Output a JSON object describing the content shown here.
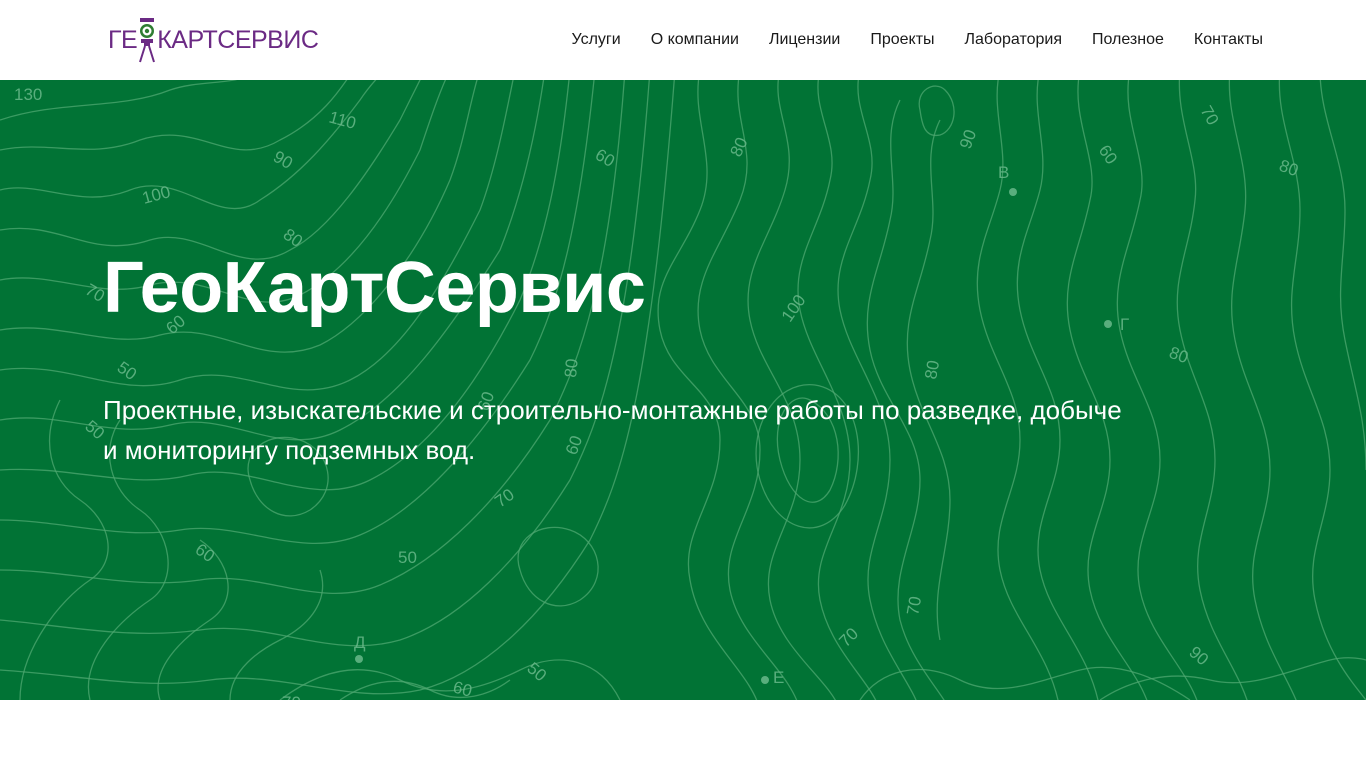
{
  "brand": {
    "logo_left": "ГЕ",
    "logo_right": "КАРТСЕРВИС",
    "logo_color": "#6b2a84",
    "mark_color": "#2e7d32"
  },
  "nav": {
    "items": [
      {
        "label": "Услуги"
      },
      {
        "label": "О компании"
      },
      {
        "label": "Лицензии"
      },
      {
        "label": "Проекты"
      },
      {
        "label": "Лаборатория"
      },
      {
        "label": "Полезное"
      },
      {
        "label": "Контакты"
      }
    ]
  },
  "hero": {
    "title": "ГеоКартСервис",
    "subtitle": "Проектные, изыскательские и строительно-монтажные работы по разведке, добыче и мониторингу подземных вод.",
    "bg_color": "#017335",
    "line_color": "#4fa872"
  },
  "map_labels": [
    "130",
    "110",
    "90",
    "100",
    "80",
    "70",
    "60",
    "50",
    "60",
    "80",
    "90",
    "60",
    "70",
    "80",
    "100",
    "80",
    "80",
    "50",
    "60",
    "70",
    "60",
    "50",
    "70",
    "80",
    "60",
    "70",
    "90",
    "50",
    "60",
    "70",
    "В",
    "Г",
    "Д",
    "Е"
  ]
}
